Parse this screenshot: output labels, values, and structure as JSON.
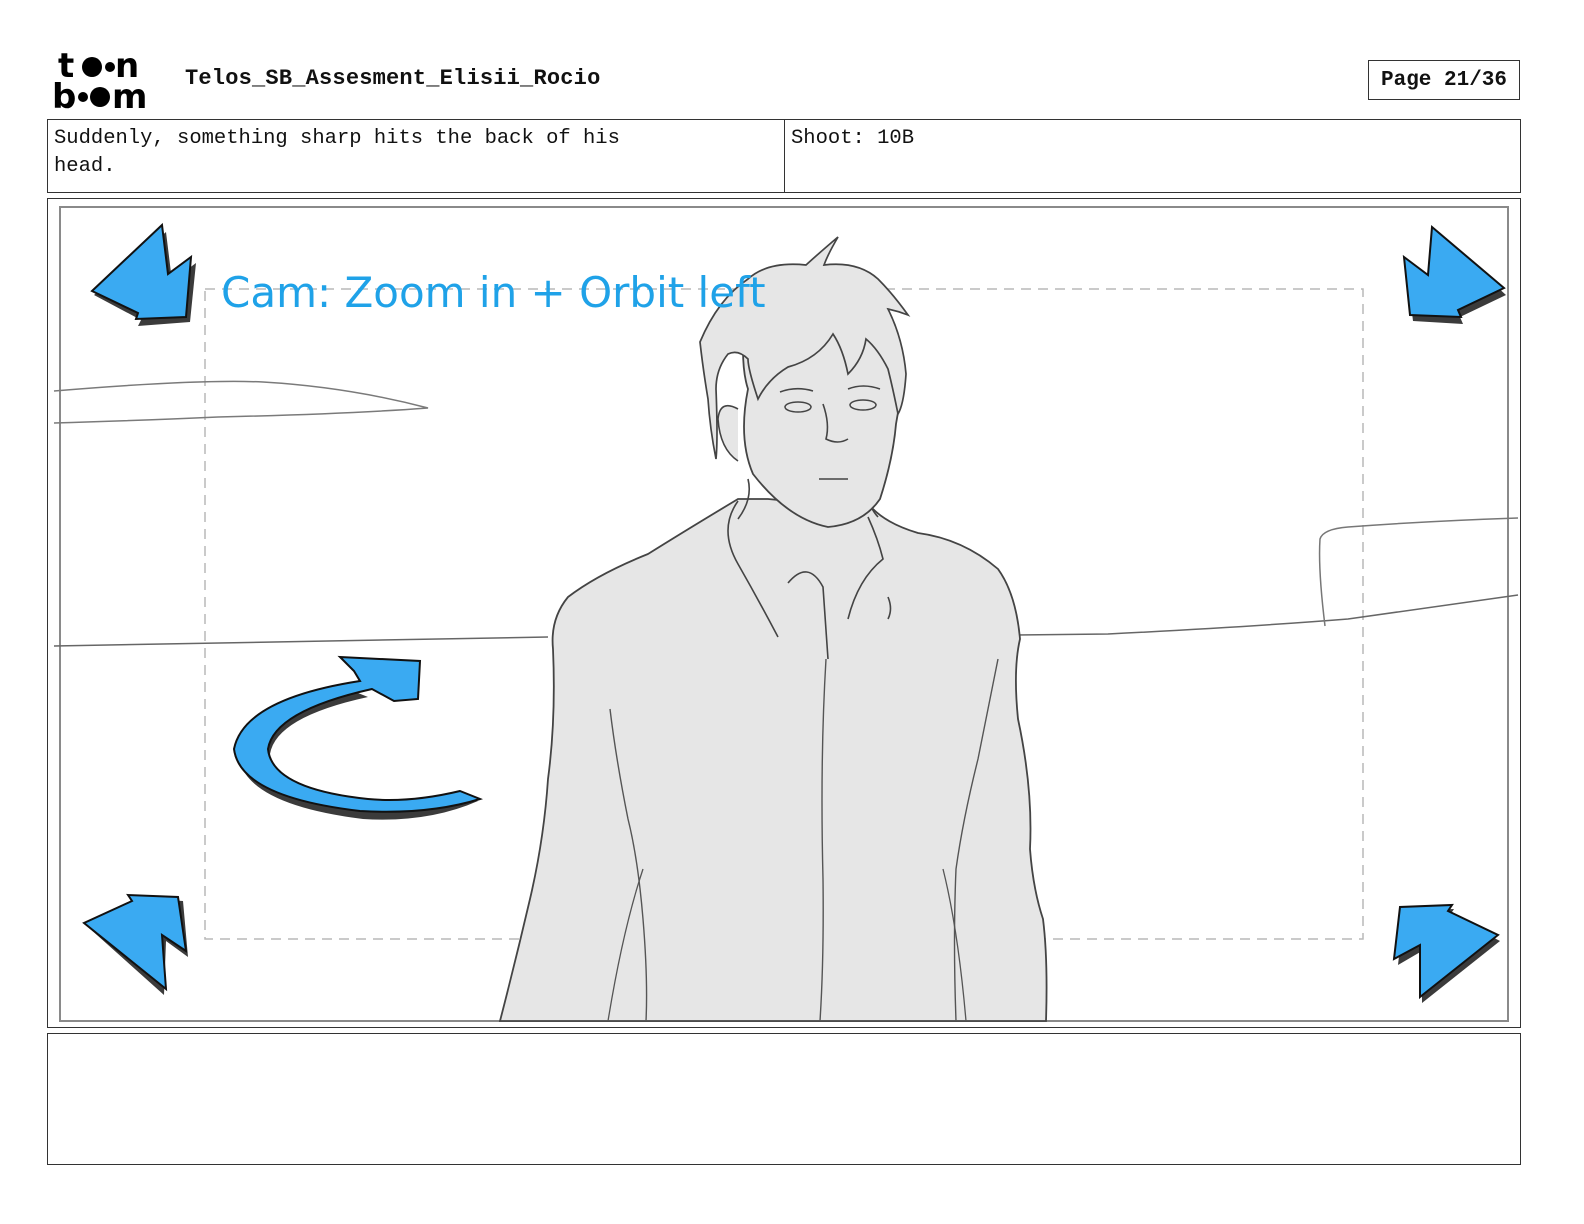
{
  "header": {
    "logo_text": "toon boom",
    "document_title": "Telos_SB_Assesment_Elisii_Rocio",
    "page_label": "Page 21/36"
  },
  "panel_info": {
    "action_text": "Suddenly, something sharp hits the back of his\nhead.",
    "shoot_text": "Shoot: 10B"
  },
  "panel": {
    "camera_note": "Cam: Zoom in + Orbit left",
    "arrow_color": "#3aaaf2",
    "arrow_shadow_color": "#3b3b3b",
    "figure_fill": "#e6e6e6",
    "camera_note_color": "#1fa2e8",
    "icons": [
      "zoom-arrow-icon",
      "orbit-left-arrow-icon"
    ]
  },
  "notes": {
    "text": ""
  }
}
